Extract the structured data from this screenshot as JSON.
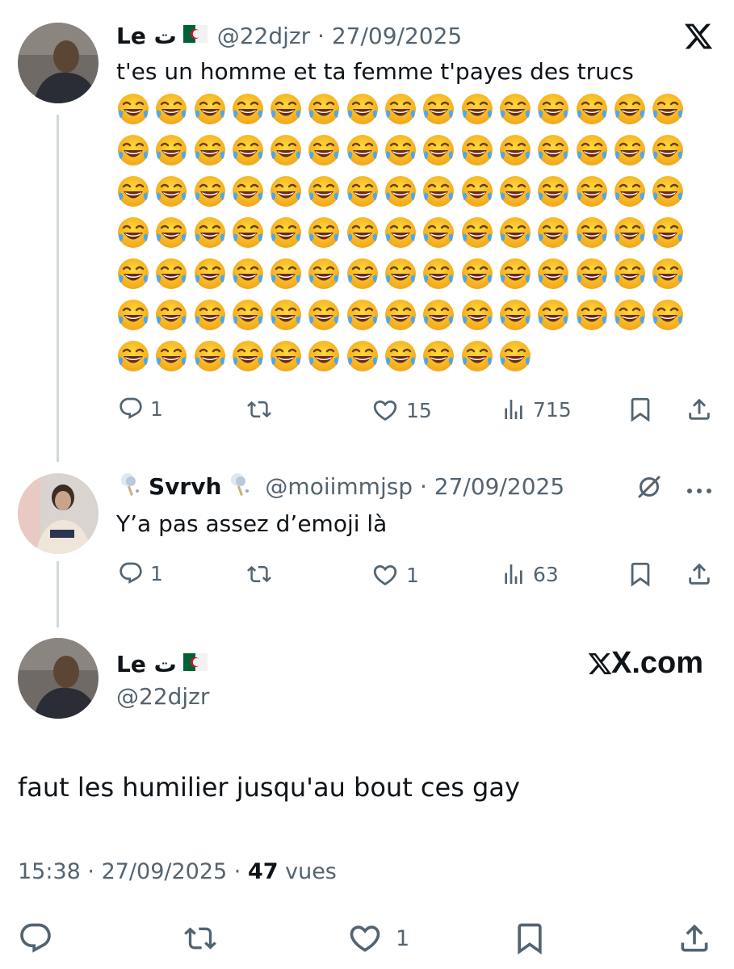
{
  "tweet1": {
    "name": "Le ت",
    "handle": "@22djzr",
    "date_sep": " · ",
    "date": "27/09/2025",
    "text": "t'es un homme et ta femme t'payes des trucs",
    "emoji": "😂",
    "emoji_count": 101,
    "actions": {
      "replies": "1",
      "reposts": "",
      "likes": "15",
      "views": "715"
    }
  },
  "tweet2": {
    "name": "Svrvh",
    "handle": "@moiimmjsp",
    "date_sep": " · ",
    "date": "27/09/2025",
    "text": "Y’a pas assez d’emoji là",
    "actions": {
      "replies": "1",
      "reposts": "",
      "likes": "1",
      "views": "63"
    }
  },
  "main": {
    "name": "Le ت",
    "handle": "@22djzr",
    "brand": "X.com",
    "text": "faut les humilier jusqu'au bout ces gay",
    "time": "15:38",
    "date_sep": " · ",
    "date": "27/09/2025",
    "views_count": "47",
    "views_label": "vues",
    "actions": {
      "likes": "1"
    }
  },
  "colors": {
    "text": "#0f1419",
    "muted": "#536471",
    "thread_line": "#cfd9de"
  },
  "icons": [
    "x-logo-icon",
    "grok-icon",
    "more-icon",
    "reply-icon",
    "repost-icon",
    "like-icon",
    "views-icon",
    "bookmark-icon",
    "share-icon",
    "algeria-flag-icon"
  ]
}
